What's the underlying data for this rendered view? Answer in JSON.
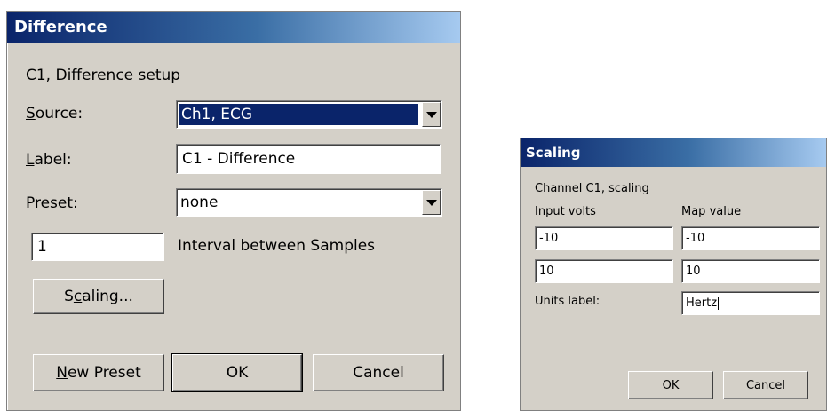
{
  "difference": {
    "title": "Difference",
    "subtitle": "C1, Difference setup",
    "source": {
      "label_first": "S",
      "label_rest": "ource:",
      "value": "Ch1, ECG"
    },
    "label_field": {
      "label_first": "L",
      "label_rest": "abel:",
      "value": "C1 - Difference"
    },
    "preset": {
      "label_first": "P",
      "label_rest": "reset:",
      "value": "none"
    },
    "interval": {
      "value": "1",
      "label": "Interval between Samples"
    },
    "scaling_button": {
      "pre": "S",
      "underlined": "c",
      "post": "aling..."
    },
    "new_preset_button": {
      "underlined": "N",
      "rest": "ew Preset"
    },
    "ok_label": "OK",
    "cancel_label": "Cancel"
  },
  "scaling": {
    "title": "Scaling",
    "channel_label": "Channel C1, scaling",
    "input_volts_header": "Input volts",
    "map_value_header": "Map value",
    "rows": [
      {
        "input": "-10",
        "map": "-10"
      },
      {
        "input": "10",
        "map": "10"
      }
    ],
    "units_label": "Units label:",
    "units_value": "Hertz",
    "ok_label": "OK",
    "cancel_label": "Cancel"
  },
  "colors": {
    "dialog_face": "#d4d0c8",
    "title_start": "#0a246a",
    "title_end": "#a6caf0",
    "selection": "#0a246a"
  }
}
